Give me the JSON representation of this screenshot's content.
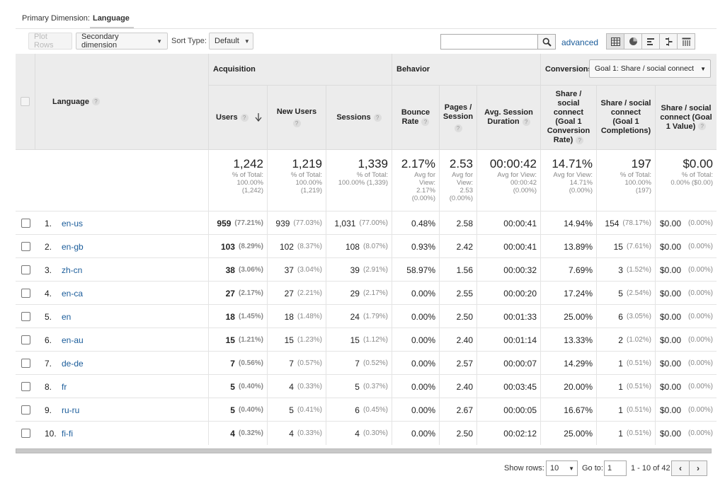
{
  "primary_dimension": {
    "label": "Primary Dimension:",
    "value": "Language"
  },
  "toolbar": {
    "plot_rows": "Plot Rows",
    "secondary_dimension": "Secondary dimension",
    "sort_type_label": "Sort Type:",
    "sort_type_value": "Default",
    "search_value": "",
    "advanced": "advanced",
    "view_icons": [
      "table-view-icon",
      "pie-view-icon",
      "performance-view-icon",
      "comparison-view-icon",
      "pivot-view-icon"
    ]
  },
  "headers": {
    "language": "Language",
    "acquisition": "Acquisition",
    "behavior": "Behavior",
    "conversions": "Conversions",
    "goal_select": "Goal 1: Share / social connect",
    "users": "Users",
    "new_users": "New Users",
    "sessions": "Sessions",
    "bounce_rate": "Bounce Rate",
    "pages_session": "Pages / Session",
    "avg_session_duration": "Avg. Session Duration",
    "conv_rate": "Share / social connect (Goal 1 Conversion Rate)",
    "completions": "Share / social connect (Goal 1 Completions)",
    "value": "Share / social connect (Goal 1 Value)"
  },
  "totals": {
    "users": {
      "big": "1,242",
      "sub1": "% of Total:",
      "sub2": "100.00%",
      "sub3": "(1,242)"
    },
    "new_users": {
      "big": "1,219",
      "sub1": "% of Total:",
      "sub2": "100.00%",
      "sub3": "(1,219)"
    },
    "sessions": {
      "big": "1,339",
      "sub1": "% of Total:",
      "sub2": "100.00% (1,339)",
      "sub3": ""
    },
    "bounce_rate": {
      "big": "2.17%",
      "sub1": "Avg for",
      "sub2": "View:",
      "sub3": "2.17%",
      "sub4": "(0.00%)"
    },
    "pages_session": {
      "big": "2.53",
      "sub1": "Avg for",
      "sub2": "View:",
      "sub3": "2.53",
      "sub4": "(0.00%)"
    },
    "avg_duration": {
      "big": "00:00:42",
      "sub1": "Avg for View:",
      "sub2": "00:00:42",
      "sub3": "(0.00%)"
    },
    "conv_rate": {
      "big": "14.71%",
      "sub1": "Avg for View:",
      "sub2": "14.71%",
      "sub3": "(0.00%)"
    },
    "completions": {
      "big": "197",
      "sub1": "% of Total:",
      "sub2": "100.00%",
      "sub3": "(197)"
    },
    "value": {
      "big": "$0.00",
      "sub1": "% of Total:",
      "sub2": "0.00% ($0.00)",
      "sub3": ""
    }
  },
  "rows": [
    {
      "num": "1.",
      "lang": "en-us",
      "users": "959",
      "users_pct": "(77.21%)",
      "new_users": "939",
      "new_users_pct": "(77.03%)",
      "sessions": "1,031",
      "sessions_pct": "(77.00%)",
      "bounce": "0.48%",
      "pages": "2.58",
      "duration": "00:00:41",
      "conv": "14.94%",
      "comp": "154",
      "comp_pct": "(78.17%)",
      "val": "$0.00",
      "val_pct": "(0.00%)"
    },
    {
      "num": "2.",
      "lang": "en-gb",
      "users": "103",
      "users_pct": "(8.29%)",
      "new_users": "102",
      "new_users_pct": "(8.37%)",
      "sessions": "108",
      "sessions_pct": "(8.07%)",
      "bounce": "0.93%",
      "pages": "2.42",
      "duration": "00:00:41",
      "conv": "13.89%",
      "comp": "15",
      "comp_pct": "(7.61%)",
      "val": "$0.00",
      "val_pct": "(0.00%)"
    },
    {
      "num": "3.",
      "lang": "zh-cn",
      "users": "38",
      "users_pct": "(3.06%)",
      "new_users": "37",
      "new_users_pct": "(3.04%)",
      "sessions": "39",
      "sessions_pct": "(2.91%)",
      "bounce": "58.97%",
      "pages": "1.56",
      "duration": "00:00:32",
      "conv": "7.69%",
      "comp": "3",
      "comp_pct": "(1.52%)",
      "val": "$0.00",
      "val_pct": "(0.00%)"
    },
    {
      "num": "4.",
      "lang": "en-ca",
      "users": "27",
      "users_pct": "(2.17%)",
      "new_users": "27",
      "new_users_pct": "(2.21%)",
      "sessions": "29",
      "sessions_pct": "(2.17%)",
      "bounce": "0.00%",
      "pages": "2.55",
      "duration": "00:00:20",
      "conv": "17.24%",
      "comp": "5",
      "comp_pct": "(2.54%)",
      "val": "$0.00",
      "val_pct": "(0.00%)"
    },
    {
      "num": "5.",
      "lang": "en",
      "users": "18",
      "users_pct": "(1.45%)",
      "new_users": "18",
      "new_users_pct": "(1.48%)",
      "sessions": "24",
      "sessions_pct": "(1.79%)",
      "bounce": "0.00%",
      "pages": "2.50",
      "duration": "00:01:33",
      "conv": "25.00%",
      "comp": "6",
      "comp_pct": "(3.05%)",
      "val": "$0.00",
      "val_pct": "(0.00%)"
    },
    {
      "num": "6.",
      "lang": "en-au",
      "users": "15",
      "users_pct": "(1.21%)",
      "new_users": "15",
      "new_users_pct": "(1.23%)",
      "sessions": "15",
      "sessions_pct": "(1.12%)",
      "bounce": "0.00%",
      "pages": "2.40",
      "duration": "00:01:14",
      "conv": "13.33%",
      "comp": "2",
      "comp_pct": "(1.02%)",
      "val": "$0.00",
      "val_pct": "(0.00%)"
    },
    {
      "num": "7.",
      "lang": "de-de",
      "users": "7",
      "users_pct": "(0.56%)",
      "new_users": "7",
      "new_users_pct": "(0.57%)",
      "sessions": "7",
      "sessions_pct": "(0.52%)",
      "bounce": "0.00%",
      "pages": "2.57",
      "duration": "00:00:07",
      "conv": "14.29%",
      "comp": "1",
      "comp_pct": "(0.51%)",
      "val": "$0.00",
      "val_pct": "(0.00%)"
    },
    {
      "num": "8.",
      "lang": "fr",
      "users": "5",
      "users_pct": "(0.40%)",
      "new_users": "4",
      "new_users_pct": "(0.33%)",
      "sessions": "5",
      "sessions_pct": "(0.37%)",
      "bounce": "0.00%",
      "pages": "2.40",
      "duration": "00:03:45",
      "conv": "20.00%",
      "comp": "1",
      "comp_pct": "(0.51%)",
      "val": "$0.00",
      "val_pct": "(0.00%)"
    },
    {
      "num": "9.",
      "lang": "ru-ru",
      "users": "5",
      "users_pct": "(0.40%)",
      "new_users": "5",
      "new_users_pct": "(0.41%)",
      "sessions": "6",
      "sessions_pct": "(0.45%)",
      "bounce": "0.00%",
      "pages": "2.67",
      "duration": "00:00:05",
      "conv": "16.67%",
      "comp": "1",
      "comp_pct": "(0.51%)",
      "val": "$0.00",
      "val_pct": "(0.00%)"
    },
    {
      "num": "10.",
      "lang": "fi-fi",
      "users": "4",
      "users_pct": "(0.32%)",
      "new_users": "4",
      "new_users_pct": "(0.33%)",
      "sessions": "4",
      "sessions_pct": "(0.30%)",
      "bounce": "0.00%",
      "pages": "2.50",
      "duration": "00:02:12",
      "conv": "25.00%",
      "comp": "1",
      "comp_pct": "(0.51%)",
      "val": "$0.00",
      "val_pct": "(0.00%)"
    }
  ],
  "pager": {
    "show_rows_label": "Show rows:",
    "show_rows_value": "10",
    "goto_label": "Go to:",
    "goto_value": "1",
    "range": "1 - 10 of 42"
  },
  "colors": {
    "link": "#1a5c9a",
    "header_bg": "#ececec",
    "border": "#e4e4e4"
  }
}
